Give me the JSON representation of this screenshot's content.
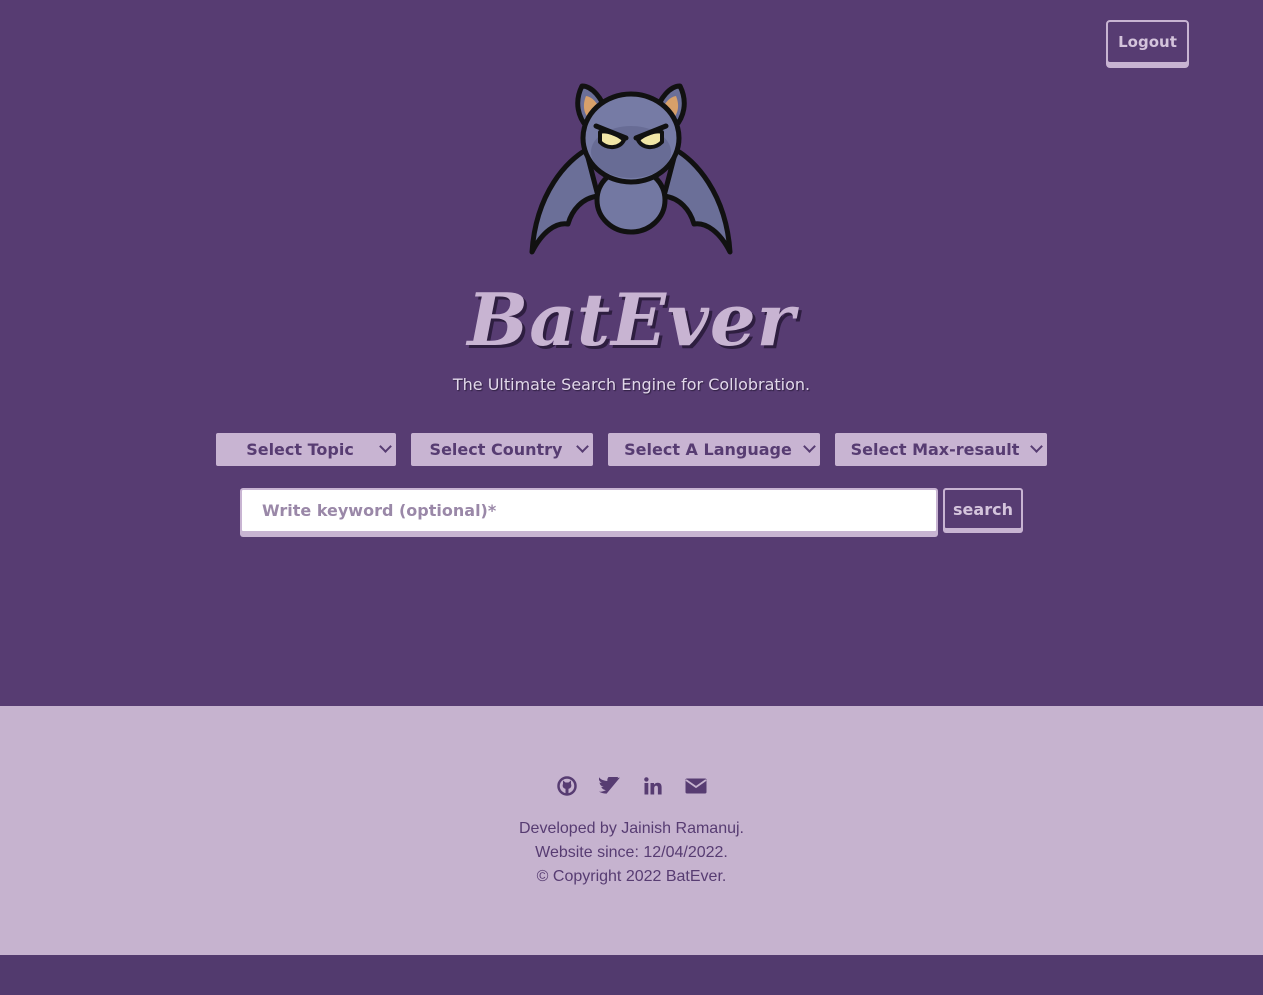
{
  "header": {
    "logout_label": "Logout"
  },
  "brand": {
    "title": "BatEver",
    "tagline": "The Ultimate Search Engine for Collobration."
  },
  "filters": {
    "topic": "Select Topic",
    "country": "Select Country",
    "language": "Select A Language",
    "max_result": "Select Max-resault"
  },
  "search": {
    "placeholder": "Write keyword (optional)*",
    "button_label": "search"
  },
  "footer": {
    "social": [
      "github-icon",
      "twitter-icon",
      "linkedin-icon",
      "envelope-icon"
    ],
    "developer": "Developed by Jainish Ramanuj.",
    "since": "Website since: 12/04/2022.",
    "copyright": "© Copyright 2022 BatEver."
  },
  "colors": {
    "background": "#573c72",
    "accent": "#c8b4d2",
    "footer": "#c6b3cf",
    "bottom_strip": "#523a6e"
  }
}
